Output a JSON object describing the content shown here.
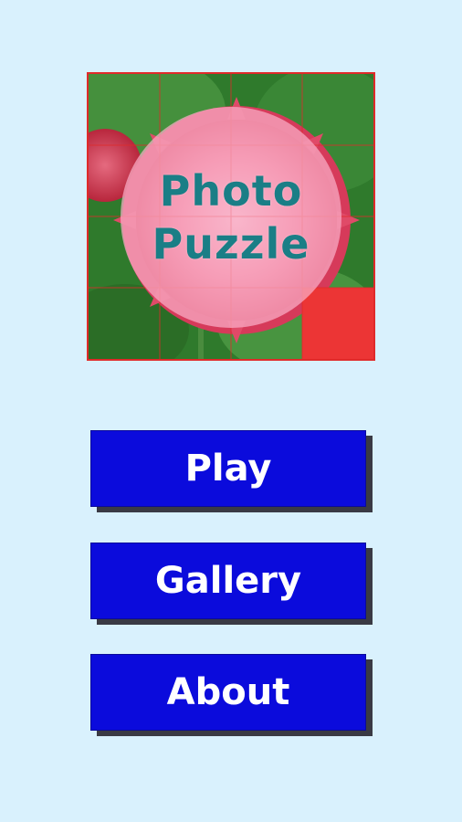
{
  "logo": {
    "title_line1": "Photo",
    "title_line2": "Puzzle",
    "grid_size": 4,
    "empty_tile_position": "bottom-right",
    "colors": {
      "border": "#e02a2a",
      "empty_tile": "#ec3535",
      "title_text": "#1a7e86",
      "circle": "#faafc8"
    }
  },
  "menu": {
    "play_label": "Play",
    "gallery_label": "Gallery",
    "about_label": "About"
  },
  "colors": {
    "background": "#d9f1fd",
    "button": "#0b0bdc",
    "button_shadow": "#3a3a44"
  }
}
